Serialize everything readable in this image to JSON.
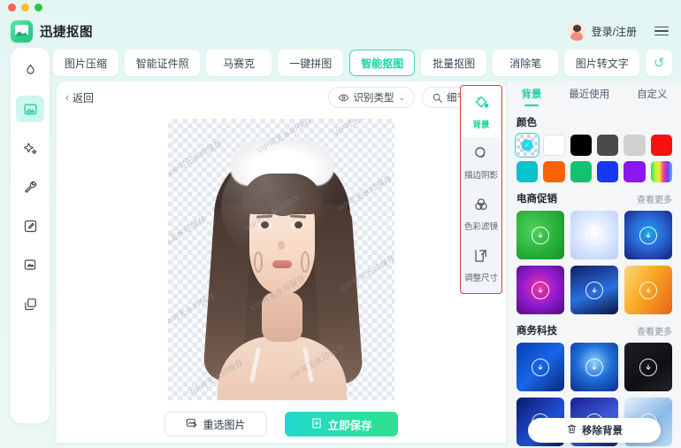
{
  "window": {
    "lights": [
      "close",
      "minimize",
      "maximize"
    ]
  },
  "header": {
    "app_title": "迅捷抠图",
    "app_icon": "app-logo-icon",
    "user_label": "登录/注册",
    "avatar_icon": "avatar",
    "menu_icon": "hamburger-menu-icon"
  },
  "tabs": [
    {
      "label": "图片压缩",
      "active": false
    },
    {
      "label": "智能证件照",
      "active": false
    },
    {
      "label": "马赛克",
      "active": false
    },
    {
      "label": "一键拼图",
      "active": false
    },
    {
      "label": "智能抠图",
      "active": true
    },
    {
      "label": "批量抠图",
      "active": false
    },
    {
      "label": "消除笔",
      "active": false
    },
    {
      "label": "图片转文字",
      "active": false
    }
  ],
  "undo": {
    "icon": "undo-arrow-icon",
    "label": "↺"
  },
  "sidebar": {
    "items": [
      {
        "name": "eraser-droplet-icon",
        "active": false
      },
      {
        "name": "image-cutout-icon",
        "active": true
      },
      {
        "name": "sparkles-icon",
        "active": false
      },
      {
        "name": "wrench-icon",
        "active": false
      },
      {
        "name": "edit-pen-icon",
        "active": false
      },
      {
        "name": "image-convert-icon",
        "active": false
      },
      {
        "name": "layers-icon",
        "active": false
      }
    ]
  },
  "editor": {
    "back_label": "返回",
    "back_chevron": "‹",
    "recognize_type": {
      "label": "识别类型",
      "icon": "eye-icon",
      "chevron": "⌄"
    },
    "detail_optimize": {
      "label": "细节优化",
      "icon": "magnifier-icon"
    },
    "watermark_text": "VIP可无水印保存",
    "buttons": {
      "reselect": {
        "label": "重选图片",
        "icon": "image-swap-icon"
      },
      "save": {
        "label": "立即保存",
        "icon": "download-box-icon"
      }
    }
  },
  "tool_rail": {
    "border_color": "#e03a3a",
    "tools": [
      {
        "label": "背景",
        "icon": "paint-bucket-icon",
        "active": true
      },
      {
        "label": "描边阴影",
        "icon": "stroke-shadow-icon",
        "active": false
      },
      {
        "label": "色彩滤镜",
        "icon": "color-filter-icon",
        "active": false
      },
      {
        "label": "调整尺寸",
        "icon": "resize-icon",
        "active": false
      }
    ]
  },
  "right_panel": {
    "tabs": [
      {
        "label": "背景",
        "active": true
      },
      {
        "label": "最近使用",
        "active": false
      },
      {
        "label": "自定义",
        "active": false
      }
    ],
    "color_section_title": "颜色",
    "colors": [
      {
        "name": "transparent",
        "hex": "transparent",
        "selected": true
      },
      {
        "name": "white",
        "hex": "#ffffff",
        "selected": false
      },
      {
        "name": "black",
        "hex": "#000000",
        "selected": false
      },
      {
        "name": "dark-gray",
        "hex": "#4a4a4a",
        "selected": false
      },
      {
        "name": "light-gray",
        "hex": "#d0d0d0",
        "selected": false
      },
      {
        "name": "red",
        "hex": "#fa0f0f",
        "selected": false
      },
      {
        "name": "cyan",
        "hex": "#0bc3cc",
        "selected": false
      },
      {
        "name": "orange",
        "hex": "#f96308",
        "selected": false
      },
      {
        "name": "green",
        "hex": "#12c271",
        "selected": false
      },
      {
        "name": "blue",
        "hex": "#1438f5",
        "selected": false
      },
      {
        "name": "purple",
        "hex": "#8a16f0",
        "selected": false
      },
      {
        "name": "rainbow",
        "hex": "rainbow",
        "selected": false
      }
    ],
    "sections": [
      {
        "title": "电商促销",
        "more_label": "查看更多",
        "thumbs": [
          {
            "name": "green-tech-bg",
            "colors": [
              "#27b13a",
              "#18a52f",
              "#53d060"
            ]
          },
          {
            "name": "white-light-burst-bg",
            "colors": [
              "#f2f6ff",
              "#c9dcff",
              "#ffffff"
            ]
          },
          {
            "name": "blue-radar-bg",
            "colors": [
              "#1b2f8f",
              "#2b66d6",
              "#19a7e8"
            ]
          },
          {
            "name": "purple-magenta-cube-bg",
            "colors": [
              "#6a17a8",
              "#c4157e",
              "#8f1ad0"
            ]
          },
          {
            "name": "blue-circuit-bg",
            "colors": [
              "#131e63",
              "#1c3fb0",
              "#2a6fe0"
            ]
          },
          {
            "name": "orange-city-bg",
            "colors": [
              "#e8631a",
              "#f9a825",
              "#fdd87a"
            ]
          }
        ]
      },
      {
        "title": "商务科技",
        "more_label": "查看更多",
        "thumbs": [
          {
            "name": "blue-beam-bg",
            "colors": [
              "#0a3fb0",
              "#1765e8",
              "#3b8cf5"
            ]
          },
          {
            "name": "blue-tunnel-bg",
            "colors": [
              "#0d2c8a",
              "#1f6fd8",
              "#8dd2ff"
            ]
          },
          {
            "name": "black-carbon-bg",
            "colors": [
              "#101014",
              "#1d1d24",
              "#2a2a33"
            ]
          },
          {
            "name": "navy-curve-bg",
            "colors": [
              "#0b1a6b",
              "#13309e",
              "#2050d6"
            ]
          },
          {
            "name": "indigo-grid-bg",
            "colors": [
              "#1a1f8a",
              "#2b3fc0",
              "#3f5be0"
            ]
          },
          {
            "name": "ice-blue-bg",
            "colors": [
              "#bcd9f2",
              "#89b9e8",
              "#e4f0fb"
            ]
          }
        ]
      }
    ],
    "thumb_icon": "download-arrow-icon",
    "float_button": {
      "label": "移除背景",
      "icon": "trash-icon"
    }
  }
}
